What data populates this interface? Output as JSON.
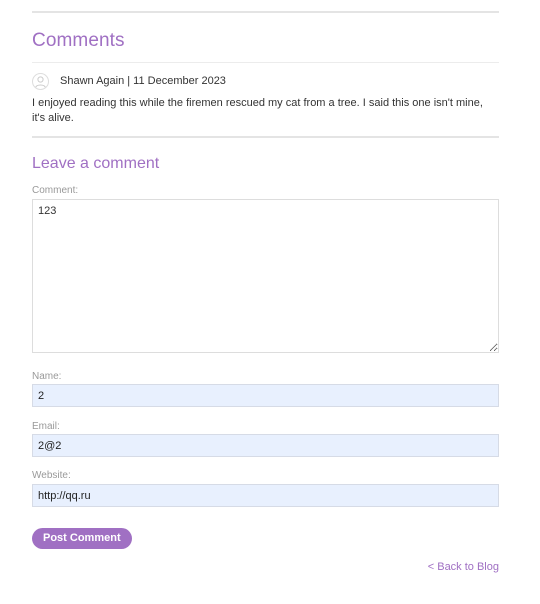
{
  "comments": {
    "heading": "Comments",
    "items": [
      {
        "author": "Shawn Again",
        "date": "11 December 2023",
        "byline": "Shawn Again | 11 December 2023",
        "body": "I enjoyed reading this while the firemen rescued my cat from a tree. I said this one isn't mine, it's alive."
      }
    ]
  },
  "form": {
    "heading": "Leave a comment",
    "comment_label": "Comment:",
    "comment_value": "123",
    "name_label": "Name:",
    "name_value": "2",
    "email_label": "Email:",
    "email_value": "2@2",
    "website_label": "Website:",
    "website_value": "http://qq.ru",
    "submit_label": "Post Comment"
  },
  "nav": {
    "back_label": "< Back to Blog"
  },
  "colors": {
    "accent": "#a070c3",
    "autofill_bg": "#e8f0fe"
  },
  "icons": {
    "avatar": "user-avatar-icon"
  }
}
